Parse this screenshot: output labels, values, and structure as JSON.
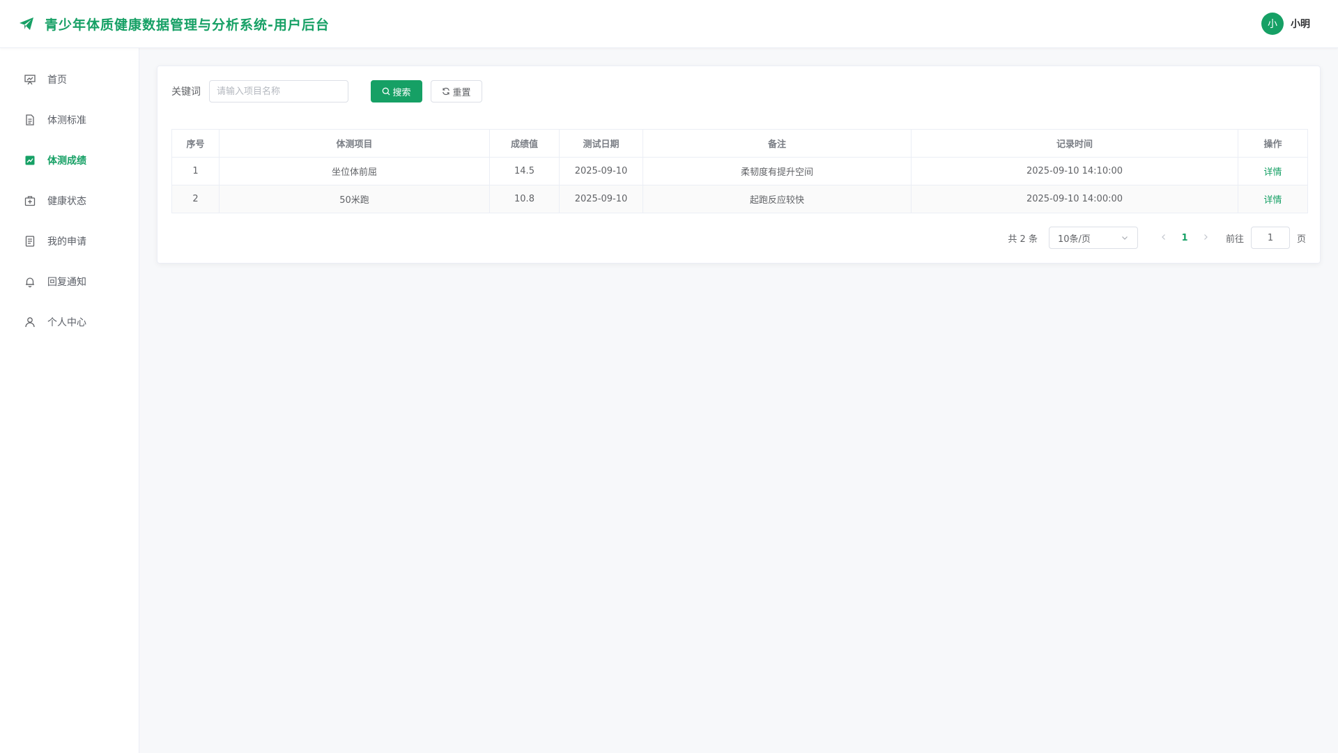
{
  "header": {
    "title": "青少年体质健康数据管理与分析系统-用户后台",
    "brand_icon": "paper-plane-icon",
    "avatar_text": "小",
    "user_name": "小明",
    "accent_color": "#16a065"
  },
  "sidebar": {
    "items": [
      {
        "label": "首页",
        "icon": "presentation-chart-icon",
        "active": false
      },
      {
        "label": "体测标准",
        "icon": "document-icon",
        "active": false
      },
      {
        "label": "体测成绩",
        "icon": "chart-line-icon",
        "active": true
      },
      {
        "label": "健康状态",
        "icon": "first-aid-kit-icon",
        "active": false
      },
      {
        "label": "我的申请",
        "icon": "list-document-icon",
        "active": false
      },
      {
        "label": "回复通知",
        "icon": "bell-icon",
        "active": false
      },
      {
        "label": "个人中心",
        "icon": "user-icon",
        "active": false
      }
    ]
  },
  "filter": {
    "label": "关键词",
    "placeholder": "请输入项目名称",
    "value": "",
    "search_label": "搜索",
    "reset_label": "重置"
  },
  "table": {
    "columns": [
      "序号",
      "体测项目",
      "成绩值",
      "测试日期",
      "备注",
      "记录时间",
      "操作"
    ],
    "rows": [
      {
        "index": "1",
        "item": "坐位体前屈",
        "score": "14.5",
        "date": "2025-09-10",
        "note": "柔韧度有提升空间",
        "record_time": "2025-09-10 14:10:00",
        "action": "详情"
      },
      {
        "index": "2",
        "item": "50米跑",
        "score": "10.8",
        "date": "2025-09-10",
        "note": "起跑反应较快",
        "record_time": "2025-09-10 14:00:00",
        "action": "详情"
      }
    ]
  },
  "pager": {
    "total_text": "共 2 条",
    "page_size": "10条/页",
    "current_page": "1",
    "goto_label": "前往",
    "goto_value": "1",
    "page_suffix": "页"
  }
}
